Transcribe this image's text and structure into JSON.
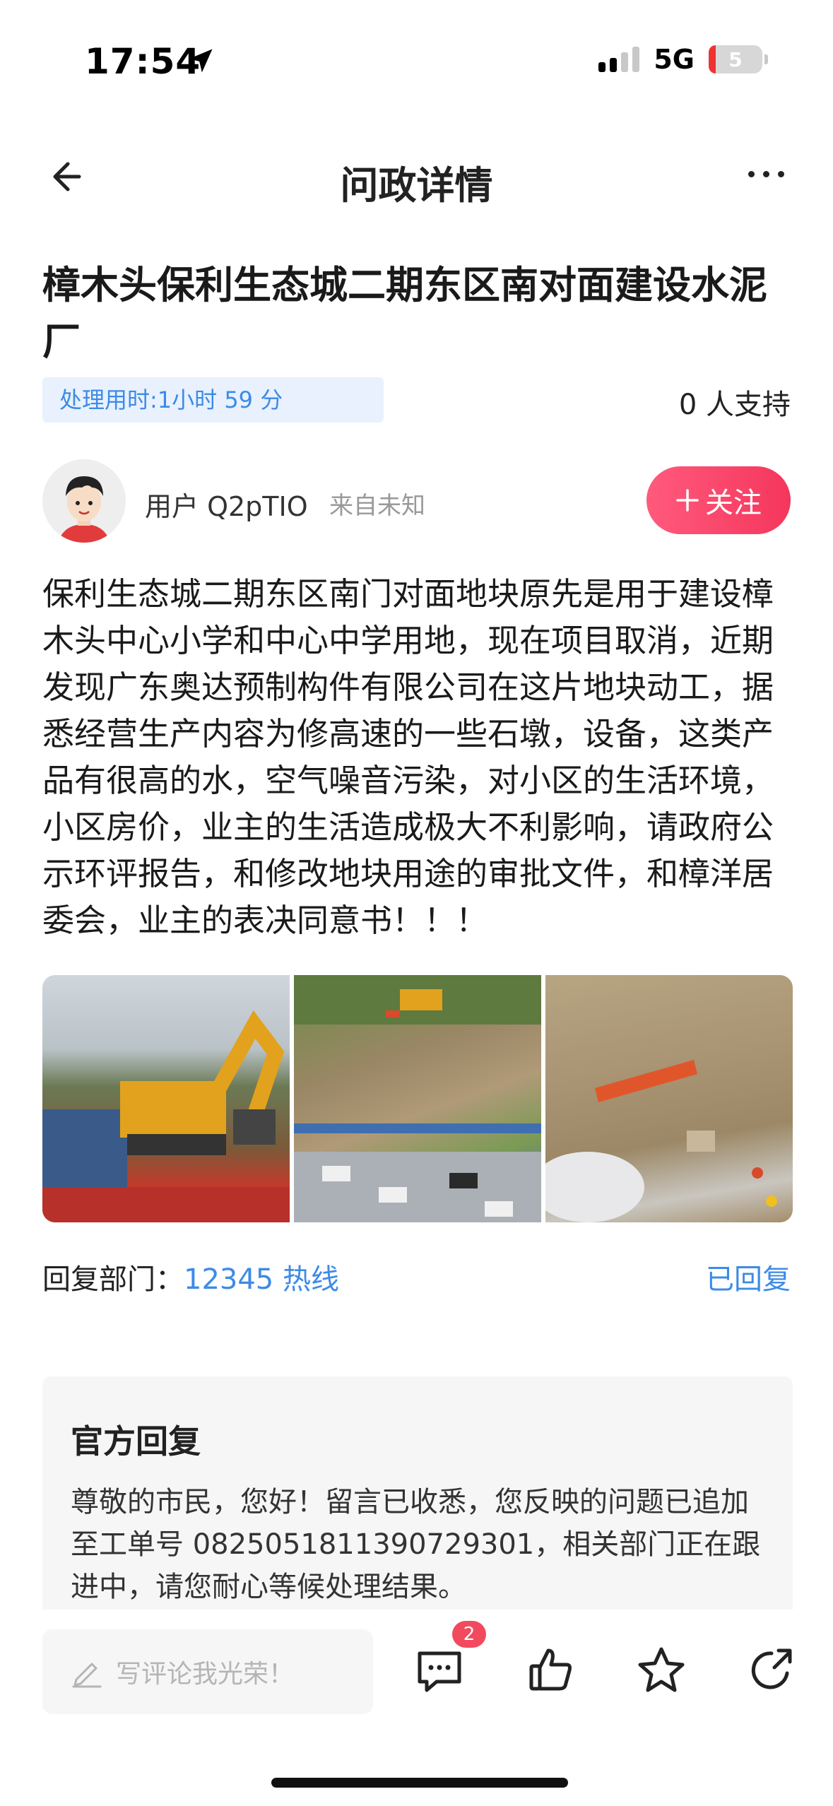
{
  "status_bar": {
    "time": "17:54",
    "network": "5G",
    "battery": "5"
  },
  "nav": {
    "title": "问政详情"
  },
  "post": {
    "title": "樟木头保利生态城二期东区南对面建设水泥厂",
    "processing_time": "处理用时:1小时 59 分",
    "support_count": "0 人支持",
    "user_name": "用户 Q2pTIO",
    "user_from": "来自未知",
    "follow_label": "关注",
    "body": "保利生态城二期东区南门对面地块原先是用于建设樟木头中心小学和中心中学用地，现在项目取消，近期发现广东奥达预制构件有限公司在这片地块动工，据悉经营生产内容为修高速的一些石墩，设备，这类产品有很高的水，空气噪音污染，对小区的生活环境，小区房价，业主的生活造成极大不利影响，请政府公示环评报告，和修改地块用途的审批文件，和樟洋居委会，业主的表决同意书！！！",
    "images": [
      "excavator-photo",
      "aerial-construction-photo",
      "site-workers-photo"
    ]
  },
  "reply": {
    "dept_label": "回复部门：",
    "dept_name": "12345 热线",
    "status": "已回复"
  },
  "official_reply": {
    "title": "官方回复",
    "text": "尊敬的市民，您好！留言已收悉，您反映的问题已追加至工单号 0825051811390729301，相关部门正在跟进中，请您耐心等候处理结果。"
  },
  "bottom_bar": {
    "comment_placeholder": "写评论我光荣！",
    "comment_count": "2"
  },
  "colors": {
    "accent_blue": "#3d8be6",
    "follow_pink": "#f5365c",
    "badge_red": "#f14a5f"
  }
}
